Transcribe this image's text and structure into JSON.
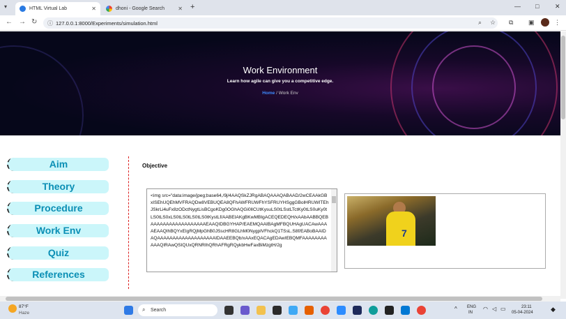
{
  "browser": {
    "tabs": [
      {
        "title": "HTML Virtual Lab",
        "active": true
      },
      {
        "title": "dhoni - Google Search",
        "active": false
      }
    ],
    "new_tab": "+",
    "url": "127.0.0.1:8000/Experiments/simulation.html",
    "window_controls": {
      "minimize": "—",
      "maximize": "□",
      "close": "✕"
    }
  },
  "hero": {
    "title": "Work Environment",
    "subtitle": "Learn how agile can give you a competitive edge.",
    "breadcrumb_home": "Home",
    "breadcrumb_sep": "/",
    "breadcrumb_current": "Work Env"
  },
  "sidebar": {
    "items": [
      {
        "label": "Aim"
      },
      {
        "label": "Theory"
      },
      {
        "label": "Procedure"
      },
      {
        "label": "Work Env"
      },
      {
        "label": "Quiz"
      },
      {
        "label": "References"
      }
    ]
  },
  "main": {
    "objective": "Objective",
    "code_text": "<img src=\"data:image/jpeg;base64,/9j/4AAQSkZJRgABAQAAAQABAAD/2wCEAAkGBxISEhUQEhMVFRAQDw8VEBUQEA8QFhAWFRUWFhYSFRUYHSggGBolHRUWITEhJSkrLi4uFx8zODctNygtLisBCgoKDg0OGhAQGi0lICUtKysuLS0tLSstLTctKy0tLS0uKy0tLS0tLS0xLS0tLS0tLS0tLS0tKystLf/AABEIAKgBKwMBIgACEQEDEQH/xAAbAABBQEBAAAAAAAAAAAAAAAAAAEAAQIDBGYHAP/EAEMQAAIBAgMFBQUHAgUACAwAAAAEAAQIhBQYxEIgRQjMpGhB0JSscHR8GLhM0NygplVFhckQ1TSsL.S8f/EABoBAAIDAQAAAAAAAAAAAAAAAAAAAIDAAEEBQb/xAAxEQACAgEDAwIEBQMFAAAAAAAAAAAQIRAwQSIQUxQRNRIhQRhAFRgRQykbHwFaxBiMzgtH/2g"
  },
  "taskbar": {
    "weather_temp": "87°F",
    "weather_desc": "Haze",
    "search_placeholder": "Search",
    "lang": "ENG",
    "region": "IN",
    "time": "23:11",
    "date": "05-04-2024"
  }
}
